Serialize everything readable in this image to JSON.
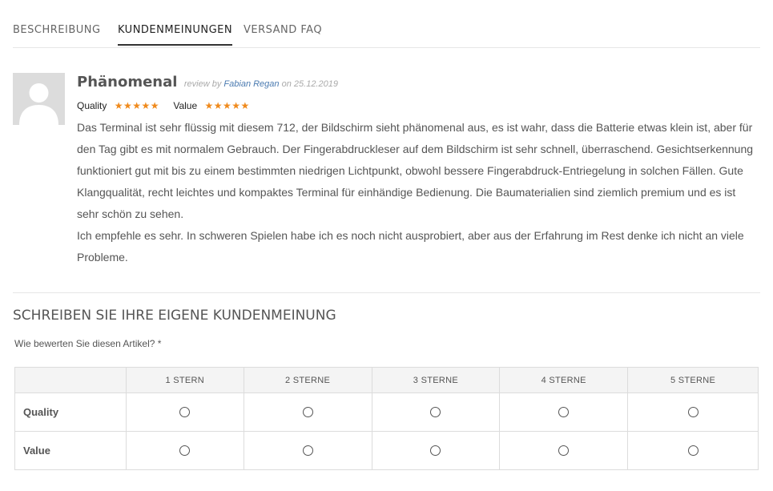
{
  "tabs": [
    {
      "label": "BESCHREIBUNG",
      "active": false
    },
    {
      "label": "KUNDENMEINUNGEN",
      "active": true
    },
    {
      "label": "VERSAND FAQ",
      "active": false
    }
  ],
  "review": {
    "title": "Phänomenal",
    "review_by": "review by",
    "author": "Fabian Regan",
    "on": "on",
    "date": "25.12.2019",
    "ratings": [
      {
        "label": "Quality",
        "stars": "★★★★★",
        "score": 5,
        "max": 5
      },
      {
        "label": "Value",
        "stars": "★★★★★",
        "score": 5,
        "max": 5
      }
    ],
    "paragraph1": "Das Terminal ist sehr flüssig mit diesem 712, der Bildschirm sieht phänomenal aus, es ist wahr, dass die Batterie etwas klein ist, aber für den Tag gibt es mit normalem Gebrauch. Der Fingerabdruckleser auf dem Bildschirm ist sehr schnell, überraschend. Gesichtserkennung funktioniert gut mit bis zu einem bestimmten niedrigen Lichtpunkt, obwohl bessere Fingerabdruck-Entriegelung in solchen Fällen. Gute Klangqualität, recht leichtes und kompaktes Terminal für einhändige Bedienung. Die Baumaterialien sind ziemlich premium und es ist sehr schön zu sehen.",
    "paragraph2": "Ich empfehle es sehr. In schweren Spielen habe ich es noch nicht ausprobiert, aber aus der Erfahrung im Rest denke ich nicht an viele Probleme."
  },
  "form": {
    "title": "SCHREIBEN SIE IHRE EIGENE KUNDENMEINUNG",
    "question": "Wie bewerten Sie diesen Artikel? *",
    "columns": [
      "1 STERN",
      "2 STERNE",
      "3 STERNE",
      "4 STERNE",
      "5 STERNE"
    ],
    "rows": [
      "Quality",
      "Value"
    ]
  },
  "colors": {
    "star": "#f08a1c",
    "author_link": "#4a7ab0",
    "text": "#555555",
    "divider": "#e6e6e6"
  },
  "icons": {
    "avatar": "default-user-avatar-icon",
    "star": "star-icon",
    "radio": "radio-button"
  }
}
